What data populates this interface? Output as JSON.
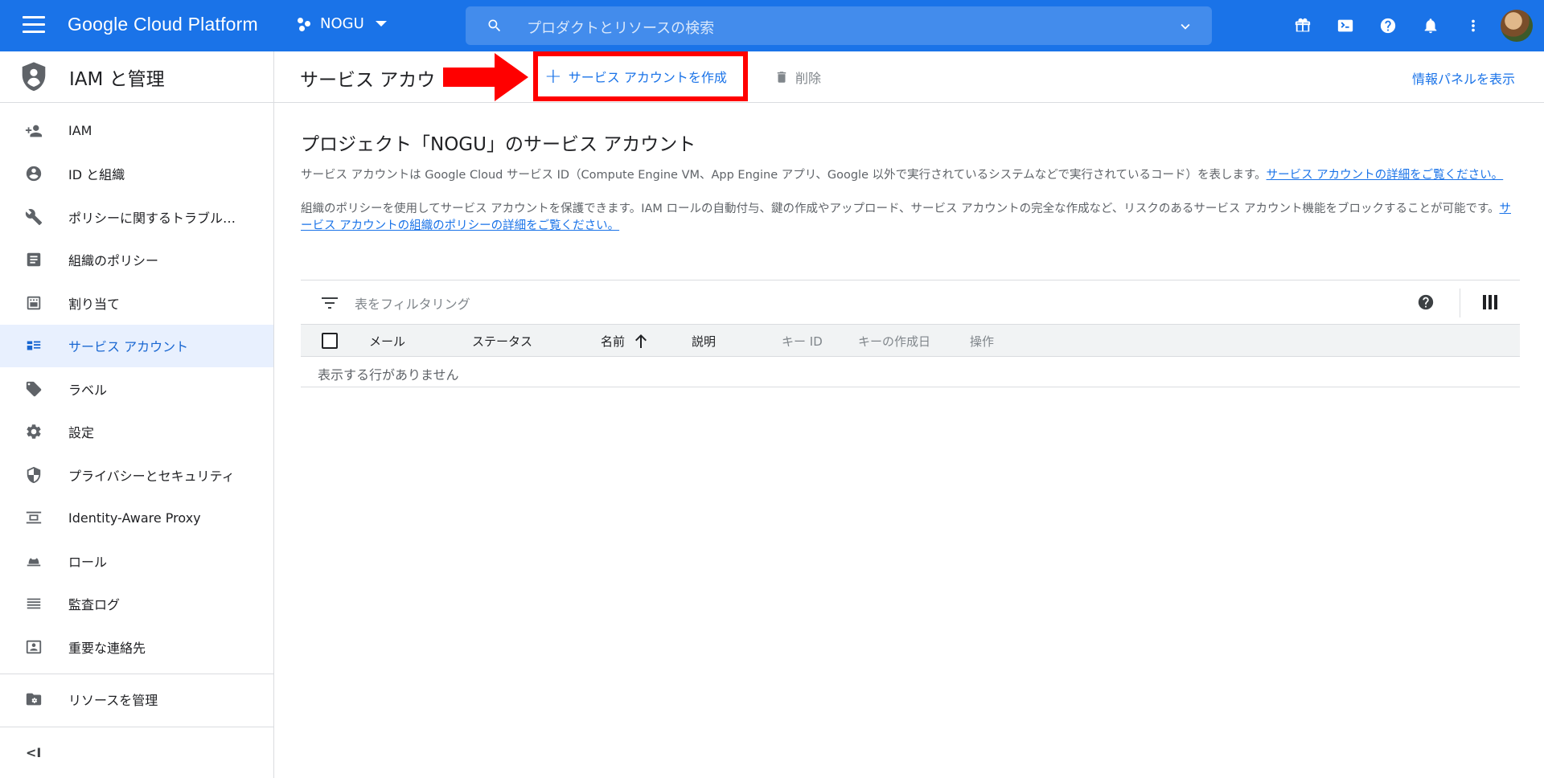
{
  "topbar": {
    "brand": "Google Cloud Platform",
    "project": "NOGU",
    "search_placeholder": "プロダクトとリソースの検索",
    "icons": [
      "gift-icon",
      "cloud-shell-icon",
      "help-icon",
      "notifications-icon",
      "more-vert-icon"
    ]
  },
  "sidebar": {
    "title": "IAM と管理",
    "items": [
      {
        "label": "IAM",
        "icon": "person-add-icon"
      },
      {
        "label": "ID と組織",
        "icon": "account-circle-icon"
      },
      {
        "label": "ポリシーに関するトラブル…",
        "icon": "wrench-icon"
      },
      {
        "label": "組織のポリシー",
        "icon": "article-icon"
      },
      {
        "label": "割り当て",
        "icon": "quota-icon"
      },
      {
        "label": "サービス アカウント",
        "icon": "service-account-icon",
        "active": true
      },
      {
        "label": "ラベル",
        "icon": "label-icon"
      },
      {
        "label": "設定",
        "icon": "settings-icon"
      },
      {
        "label": "プライバシーとセキュリティ",
        "icon": "shield-icon"
      },
      {
        "label": "Identity-Aware Proxy",
        "icon": "iap-icon"
      },
      {
        "label": "ロール",
        "icon": "role-hat-icon"
      },
      {
        "label": "監査ログ",
        "icon": "list-icon"
      },
      {
        "label": "重要な連絡先",
        "icon": "contact-icon"
      }
    ],
    "manage_resources": "リソースを管理",
    "collapse_label": "<I"
  },
  "toolbar": {
    "page_title": "サービス アカウ",
    "create_label": "サービス アカウントを作成",
    "delete_label": "削除",
    "info_panel_label": "情報パネルを表示"
  },
  "content": {
    "heading": "プロジェクト「NOGU」のサービス アカウント",
    "para1": "サービス アカウントは Google Cloud サービス ID（Compute Engine VM、App Engine アプリ、Google 以外で実行されているシステムなどで実行されているコード）を表します。",
    "para1_link": "サービス アカウントの詳細をご覧ください。",
    "para2": "組織のポリシーを使用してサービス アカウントを保護できます。IAM ロールの自動付与、鍵の作成やアップロード、サービス アカウントの完全な作成など、リスクのあるサービス アカウント機能をブロックすることが可能です。",
    "para2_link": "サービス アカウントの組織のポリシーの詳細をご覧ください。"
  },
  "table": {
    "filter_placeholder": "表をフィルタリング",
    "columns": {
      "email": "メール",
      "status": "ステータス",
      "name": "名前",
      "description": "説明",
      "key_id": "キー ID",
      "key_created": "キーの作成日",
      "actions": "操作"
    },
    "empty_message": "表示する行がありません"
  },
  "colors": {
    "primary": "#1a73e8",
    "highlight": "#ff0000",
    "active_bg": "#e8f0fe"
  }
}
